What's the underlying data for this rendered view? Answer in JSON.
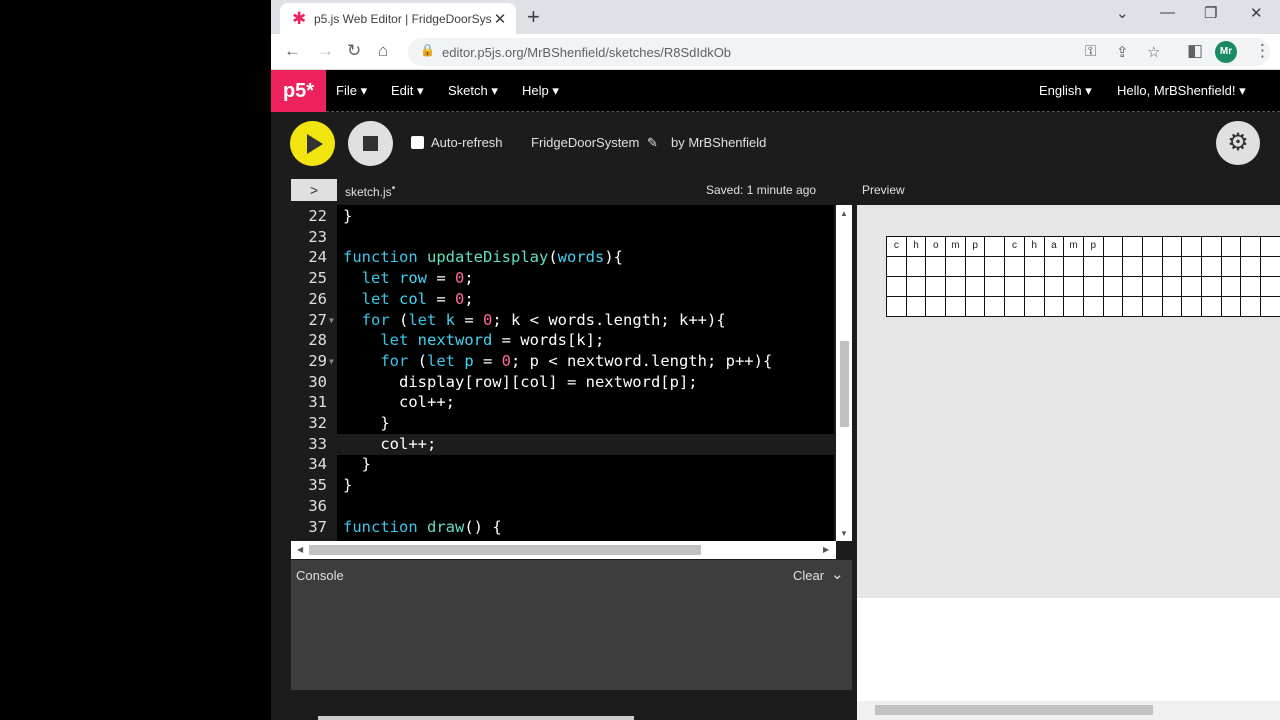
{
  "browser": {
    "tab_title": "p5.js Web Editor | FridgeDoorSys",
    "url": "editor.p5js.org/MrBShenfield/sketches/R8SdIdkOb",
    "avatar_initials": "Mr"
  },
  "p5nav": {
    "logo": "p5*",
    "menus": [
      "File",
      "Edit",
      "Sketch",
      "Help"
    ],
    "language": "English",
    "greeting": "Hello, MrBShenfield!"
  },
  "sketch_toolbar": {
    "auto_refresh_label": "Auto-refresh",
    "sketch_name": "FridgeDoorSystem",
    "author": "by MrBShenfield"
  },
  "editor": {
    "file_name": "sketch.js",
    "save_status": "Saved: 1 minute ago",
    "preview_label": "Preview",
    "lines": [
      {
        "n": "22",
        "code": [
          [
            "pl",
            "}"
          ]
        ]
      },
      {
        "n": "23",
        "code": []
      },
      {
        "n": "24",
        "code": [
          [
            "kw",
            "function "
          ],
          [
            "fn",
            "updateDisplay"
          ],
          [
            "pl",
            "("
          ],
          [
            "vs",
            "words"
          ],
          [
            "pl",
            "){"
          ]
        ]
      },
      {
        "n": "25",
        "code": [
          [
            "pl",
            "  "
          ],
          [
            "kw",
            "let "
          ],
          [
            "vs",
            "row"
          ],
          [
            "pl",
            " = "
          ],
          [
            "nm",
            "0"
          ],
          [
            "pl",
            ";"
          ]
        ]
      },
      {
        "n": "26",
        "code": [
          [
            "pl",
            "  "
          ],
          [
            "kw",
            "let "
          ],
          [
            "vs",
            "col"
          ],
          [
            "pl",
            " = "
          ],
          [
            "nm",
            "0"
          ],
          [
            "pl",
            ";"
          ]
        ]
      },
      {
        "n": "27",
        "code": [
          [
            "pl",
            "  "
          ],
          [
            "kw",
            "for "
          ],
          [
            "pl",
            "("
          ],
          [
            "kw",
            "let "
          ],
          [
            "vs",
            "k"
          ],
          [
            "pl",
            " = "
          ],
          [
            "nm",
            "0"
          ],
          [
            "pl",
            "; k < words.length; k++){"
          ]
        ]
      },
      {
        "n": "28",
        "code": [
          [
            "pl",
            "    "
          ],
          [
            "kw",
            "let "
          ],
          [
            "vs",
            "nextword"
          ],
          [
            "pl",
            " = words[k];"
          ]
        ]
      },
      {
        "n": "29",
        "code": [
          [
            "pl",
            "    "
          ],
          [
            "kw",
            "for "
          ],
          [
            "pl",
            "("
          ],
          [
            "kw",
            "let "
          ],
          [
            "vs",
            "p"
          ],
          [
            "pl",
            " = "
          ],
          [
            "nm",
            "0"
          ],
          [
            "pl",
            "; p < nextword.length; p++){"
          ]
        ]
      },
      {
        "n": "30",
        "code": [
          [
            "pl",
            "      display[row][col] = nextword[p];"
          ]
        ]
      },
      {
        "n": "31",
        "code": [
          [
            "pl",
            "      col++;"
          ]
        ]
      },
      {
        "n": "32",
        "code": [
          [
            "pl",
            "    }"
          ]
        ]
      },
      {
        "n": "33",
        "code": [
          [
            "pl",
            "    col++;"
          ]
        ]
      },
      {
        "n": "34",
        "code": [
          [
            "pl",
            "  }"
          ]
        ]
      },
      {
        "n": "35",
        "code": [
          [
            "pl",
            "}"
          ]
        ]
      },
      {
        "n": "36",
        "code": []
      },
      {
        "n": "37",
        "code": [
          [
            "kw",
            "function "
          ],
          [
            "fn",
            "draw"
          ],
          [
            "pl",
            "() {"
          ]
        ]
      }
    ]
  },
  "console": {
    "title": "Console",
    "clear_label": "Clear"
  },
  "preview": {
    "grid_rows": [
      [
        "c",
        "h",
        "o",
        "m",
        "p",
        "",
        "c",
        "h",
        "a",
        "m",
        "p",
        "",
        "",
        "",
        "",
        "",
        "",
        "",
        "",
        ""
      ],
      [
        "",
        "",
        "",
        "",
        "",
        "",
        "",
        "",
        "",
        "",
        "",
        "",
        "",
        "",
        "",
        "",
        "",
        "",
        "",
        ""
      ],
      [
        "",
        "",
        "",
        "",
        "",
        "",
        "",
        "",
        "",
        "",
        "",
        "",
        "",
        "",
        "",
        "",
        "",
        "",
        "",
        ""
      ],
      [
        "",
        "",
        "",
        "",
        "",
        "",
        "",
        "",
        "",
        "",
        "",
        "",
        "",
        "",
        "",
        "",
        "",
        "",
        "",
        ""
      ]
    ]
  },
  "colors": {
    "p5_pink": "#ed225d",
    "play_yellow": "#f1e40f",
    "keyword": "#3cc6e8",
    "number": "#ff6a9f"
  }
}
